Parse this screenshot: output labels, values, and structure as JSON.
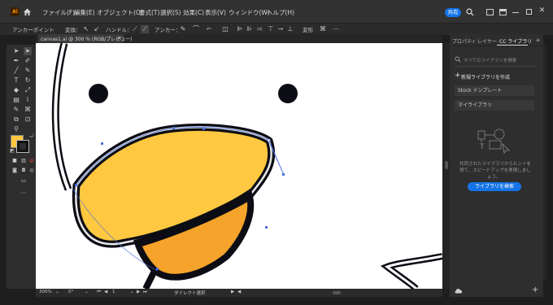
{
  "menubar": {
    "logo": "Ai",
    "items": [
      "ファイル(F)",
      "編集(E)",
      "オブジェクト(O)",
      "書式(T)",
      "選択(S)",
      "効果(C)",
      "表示(V)",
      "ウィンドウ(W)",
      "ヘルプ(H)"
    ],
    "share_label": "共有"
  },
  "controlbar": {
    "mode_label": "アンカーポイント",
    "convert_label": "変換：",
    "handle_label": "ハンドル：",
    "anchor_label": "アンカー：",
    "transform_label": "変形"
  },
  "document": {
    "tab_title": "canvas1.ai @ 300 % (RGB/プレビュー)",
    "close_glyph": "×"
  },
  "statusbar": {
    "zoom": "300%",
    "rotation": "0°",
    "artboard_nav": "1",
    "tool_name": "ダイレクト選択"
  },
  "right_panel": {
    "tabs": [
      "プロパティ",
      "レイヤー",
      "CC ライブラリ"
    ],
    "search_placeholder": "すべてのライブラリを検索",
    "create_library_label": "新規ライブラリを作成",
    "libraries": [
      "Stock テンプレート",
      "マイライブラリ"
    ],
    "hint_text_line1": "共同されたライブラリからヒントを",
    "hint_text_line2": "得て、スピードアップを実現しまし",
    "hint_text_line3": "ょう。",
    "search_button_label": "ライブラリを検索"
  },
  "colors": {
    "accent": "#1473e6",
    "beak_yellow": "#ffc840",
    "mouth_orange": "#f5a32a",
    "fill_swatch": "#ffc840"
  }
}
